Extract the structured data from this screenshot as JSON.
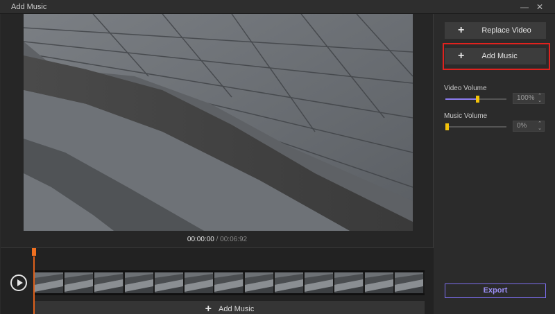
{
  "window": {
    "title": "Add Music",
    "minimize_glyph": "—",
    "close_glyph": "✕"
  },
  "player": {
    "current_time": "00:00:00",
    "separator": " / ",
    "total_time": "00:06:92"
  },
  "timeline": {
    "add_music_label": "Add Music",
    "frame_count": 13
  },
  "sidebar": {
    "replace_video_label": "Replace Video",
    "add_music_label": "Add Music",
    "video_volume": {
      "label": "Video Volume",
      "value_text": "100%",
      "level": 0.52
    },
    "music_volume": {
      "label": "Music Volume",
      "value_text": "0%",
      "level": 0.0
    },
    "export_label": "Export"
  },
  "icons": {
    "plus": "+",
    "play": "play-icon",
    "spin_up": "⌃",
    "spin_down": "⌄"
  },
  "colors": {
    "accent": "#8b7cf0",
    "playhead": "#e0621c",
    "highlight": "#e0221e",
    "knob": "#f2c20a"
  }
}
